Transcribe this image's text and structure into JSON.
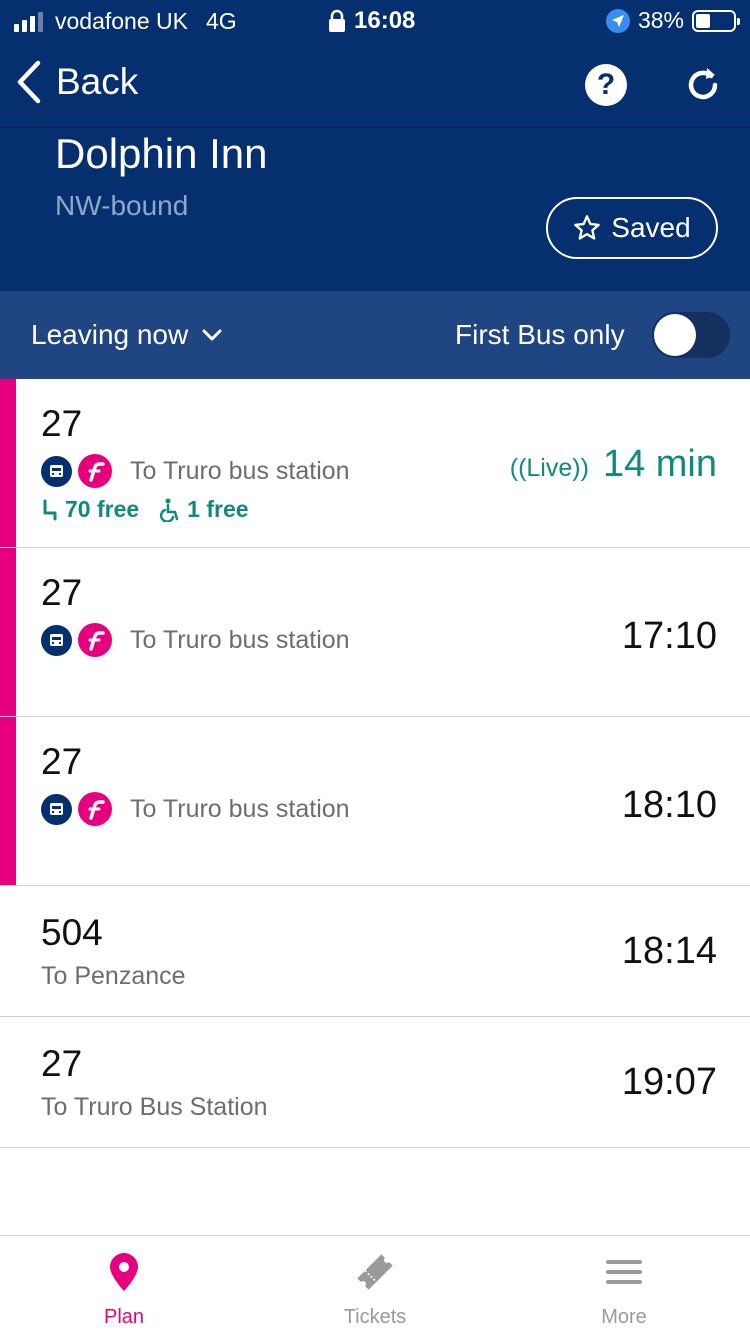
{
  "status_bar": {
    "carrier": "vodafone UK",
    "network": "4G",
    "time": "16:08",
    "battery": "38%",
    "battery_level": 0.38
  },
  "nav": {
    "back_label": "Back"
  },
  "header": {
    "stop_name": "Dolphin Inn",
    "direction": "NW-bound",
    "saved_label": "Saved"
  },
  "filter": {
    "leaving_label": "Leaving now",
    "first_bus_label": "First Bus only",
    "first_bus_only": false
  },
  "departures": [
    {
      "route": "27",
      "destination": "To Truro bus station",
      "live_label": "Live",
      "time": "14 min",
      "seats_free": "70 free",
      "wheelchair_free": "1 free"
    },
    {
      "route": "27",
      "destination": "To Truro bus station",
      "time": "17:10"
    },
    {
      "route": "27",
      "destination": "To Truro bus station",
      "time": "18:10"
    },
    {
      "route": "504",
      "destination": "To Penzance",
      "time": "18:14"
    },
    {
      "route": "27",
      "destination": "To Truro Bus Station",
      "time": "19:07"
    }
  ],
  "tabs": [
    {
      "label": "Plan",
      "icon": "map-pin-icon",
      "active": true
    },
    {
      "label": "Tickets",
      "icon": "ticket-icon",
      "active": false
    },
    {
      "label": "More",
      "icon": "menu-icon",
      "active": false
    }
  ],
  "colors": {
    "primary": "#052f6e",
    "filter_bar": "#1f4582",
    "accent": "#e6007e",
    "live": "#108a7c"
  }
}
